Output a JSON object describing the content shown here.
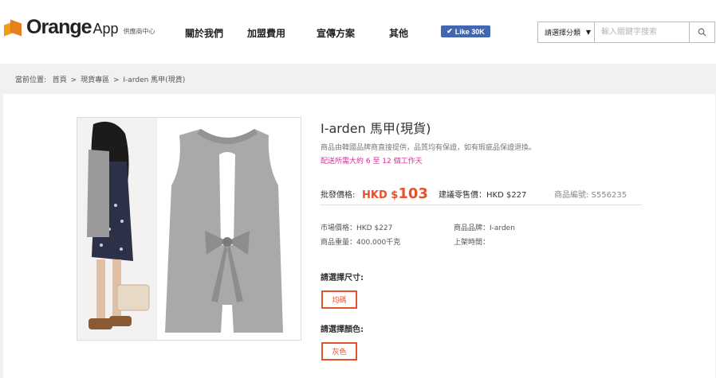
{
  "header": {
    "logo_main": "Orange",
    "logo_app": "App",
    "logo_sub": "供應商中心",
    "nav": [
      "關於我們",
      "加盟費用",
      "宣傳方案",
      "其他"
    ],
    "like_label": "Like 30K",
    "category_select": "請選擇分類",
    "search_placeholder": "輸入關鍵字搜索"
  },
  "breadcrumb": {
    "prefix": "當前位置:",
    "items": [
      "首頁",
      ">",
      "現貨專區",
      ">",
      "I-arden 馬甲(現貨)"
    ]
  },
  "product": {
    "title": "I-arden 馬甲(現貨)",
    "description": "商品由韓國品牌商直接提供，品質均有保證，如有瑕疵品保證退換。",
    "shipping": "配送所需大約 6 至 12 個工作天",
    "wholesale_label": "批發價格:",
    "wholesale_currency": "HKD $",
    "wholesale_price": "103",
    "rrp": "建議零售價：HKD $227",
    "sku": "商品編號: S556235",
    "market_price": "市場價格：HKD $227",
    "brand": "商品品牌：I-arden",
    "weight": "商品重量：400.000千克",
    "listed": "上架時間：",
    "size_label": "請選擇尺寸:",
    "size_option": "均碼",
    "color_label": "請選擇顏色:",
    "color_option": "灰色"
  },
  "colors": {
    "accent": "#e3522d",
    "shipping": "#e6259b",
    "like_bg": "#4267b2"
  }
}
